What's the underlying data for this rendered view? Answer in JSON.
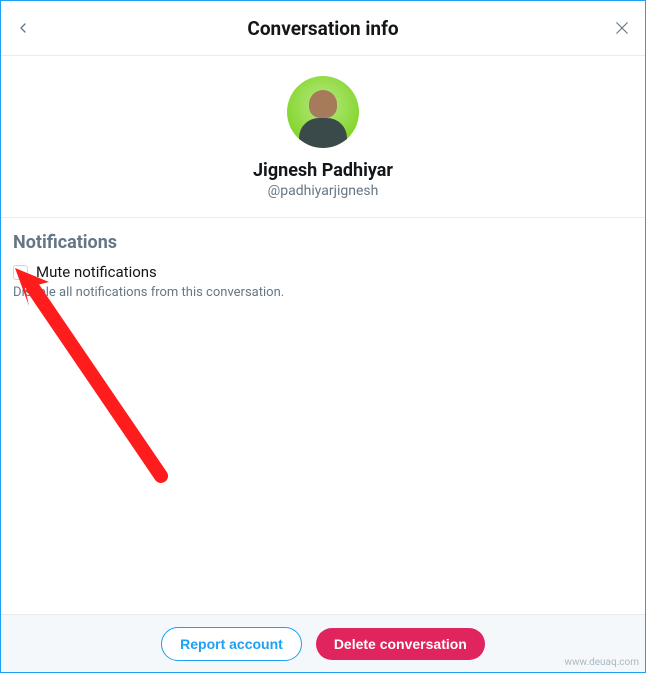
{
  "header": {
    "title": "Conversation info"
  },
  "profile": {
    "name": "Jignesh Padhiyar",
    "handle": "@padhiyarjignesh"
  },
  "notifications": {
    "heading": "Notifications",
    "mute_label": "Mute notifications",
    "description": "Disable all notifications from this conversation."
  },
  "footer": {
    "report_label": "Report account",
    "delete_label": "Delete conversation"
  },
  "watermark": "www.deuaq.com"
}
